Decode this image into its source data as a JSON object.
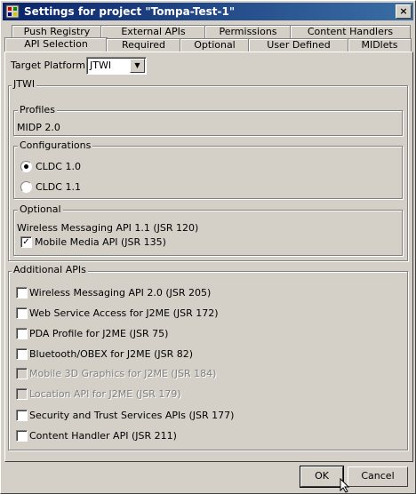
{
  "window": {
    "title": "Settings for project \"Tompa-Test-1\"",
    "close_glyph": "×"
  },
  "tabs_row1": [
    "Push Registry",
    "External APIs",
    "Permissions",
    "Content Handlers"
  ],
  "tabs_row2": [
    "API Selection",
    "Required",
    "Optional",
    "User Defined",
    "MIDlets"
  ],
  "active_tab": "API Selection",
  "target_platform": {
    "label": "Target Platform",
    "value": "JTWI"
  },
  "jtwi": {
    "legend": "JTWI",
    "profiles": {
      "legend": "Profiles",
      "value": "MIDP 2.0"
    },
    "configurations": {
      "legend": "Configurations",
      "options": [
        {
          "label": "CLDC 1.0",
          "selected": true
        },
        {
          "label": "CLDC 1.1",
          "selected": false
        }
      ]
    },
    "optional": {
      "legend": "Optional",
      "static_item": "Wireless Messaging API 1.1 (JSR 120)",
      "checkbox": {
        "label": "Mobile Media API (JSR 135)",
        "checked": true
      }
    }
  },
  "additional_apis": {
    "legend": "Additional APIs",
    "items": [
      {
        "label": "Wireless Messaging API 2.0 (JSR 205)",
        "checked": false,
        "enabled": true
      },
      {
        "label": "Web Service Access for J2ME (JSR 172)",
        "checked": false,
        "enabled": true
      },
      {
        "label": "PDA Profile for J2ME (JSR 75)",
        "checked": false,
        "enabled": true
      },
      {
        "label": "Bluetooth/OBEX for J2ME (JSR 82)",
        "checked": false,
        "enabled": true
      },
      {
        "label": "Mobile 3D Graphics for J2ME (JSR 184)",
        "checked": false,
        "enabled": false
      },
      {
        "label": "Location API for J2ME (JSR 179)",
        "checked": false,
        "enabled": false
      },
      {
        "label": "Security and Trust Services APIs (JSR 177)",
        "checked": false,
        "enabled": true
      },
      {
        "label": "Content Handler API (JSR 211)",
        "checked": false,
        "enabled": true
      }
    ]
  },
  "buttons": {
    "ok": "OK",
    "cancel": "Cancel"
  },
  "colors": {
    "titlebar_start": "#0a246a",
    "titlebar_end": "#3a6ea5",
    "face": "#d4d0c8"
  }
}
